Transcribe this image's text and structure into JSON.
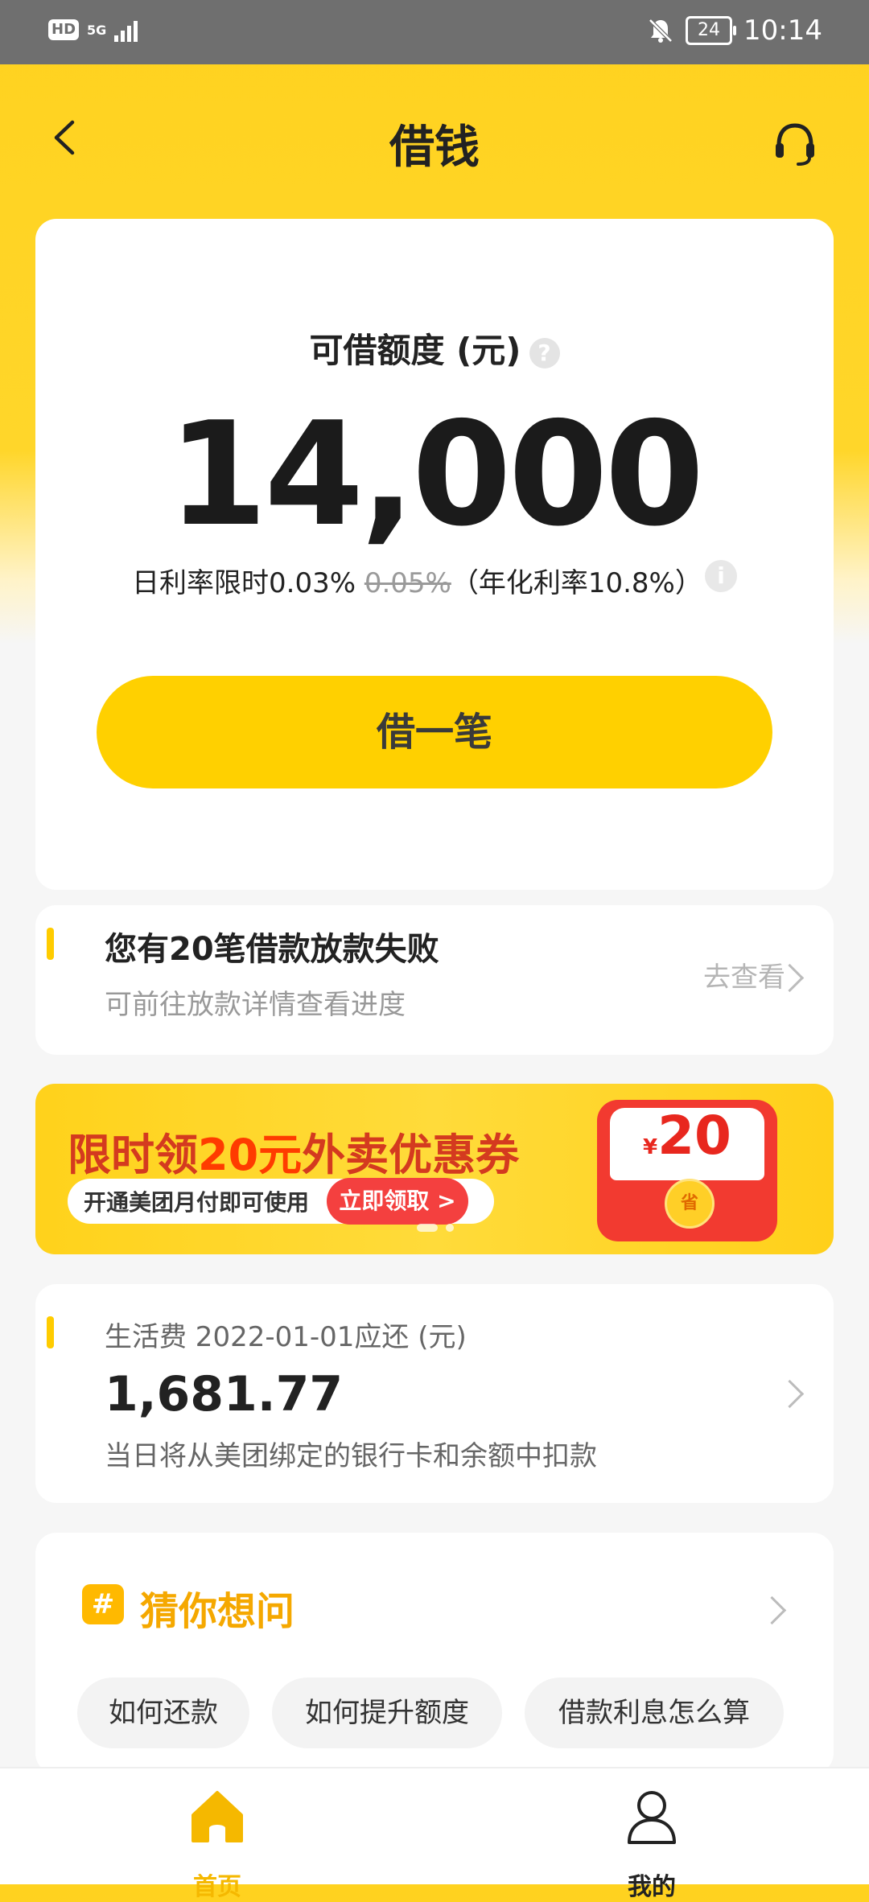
{
  "status_bar": {
    "hd": "HD",
    "network": "5G",
    "battery": "24",
    "time": "10:14"
  },
  "header": {
    "title": "借钱"
  },
  "credit": {
    "label": "可借额度 (元)",
    "amount": "14,000",
    "rate_prefix": "日利率限时0.03% ",
    "rate_original": "0.05%",
    "rate_suffix": "（年化利率10.8%）",
    "borrow_button": "借一笔"
  },
  "notice": {
    "title": "您有20笔借款放款失败",
    "subtitle": "可前往放款详情查看进度",
    "link": "去查看"
  },
  "banner": {
    "title_pre": "限时领",
    "title_highlight": "20元",
    "title_post": "外卖优惠券",
    "pill_text": "开通美团月付即可使用",
    "cta": "立即领取 >",
    "envelope_currency": "¥",
    "envelope_amount": "20",
    "coin_text": "省",
    "pages": 2,
    "active_page": 1
  },
  "repayment": {
    "label": "生活费 2022-01-01应还 (元)",
    "amount": "1,681.77",
    "note": "当日将从美团绑定的银行卡和余额中扣款"
  },
  "faq": {
    "icon_text": "#",
    "title": "猜你想问",
    "questions": [
      "如何还款",
      "如何提升额度",
      "借款利息怎么算"
    ]
  },
  "bottom_nav": {
    "home": "首页",
    "mine": "我的",
    "active_color": "#f5b800",
    "inactive_color": "#222222"
  }
}
